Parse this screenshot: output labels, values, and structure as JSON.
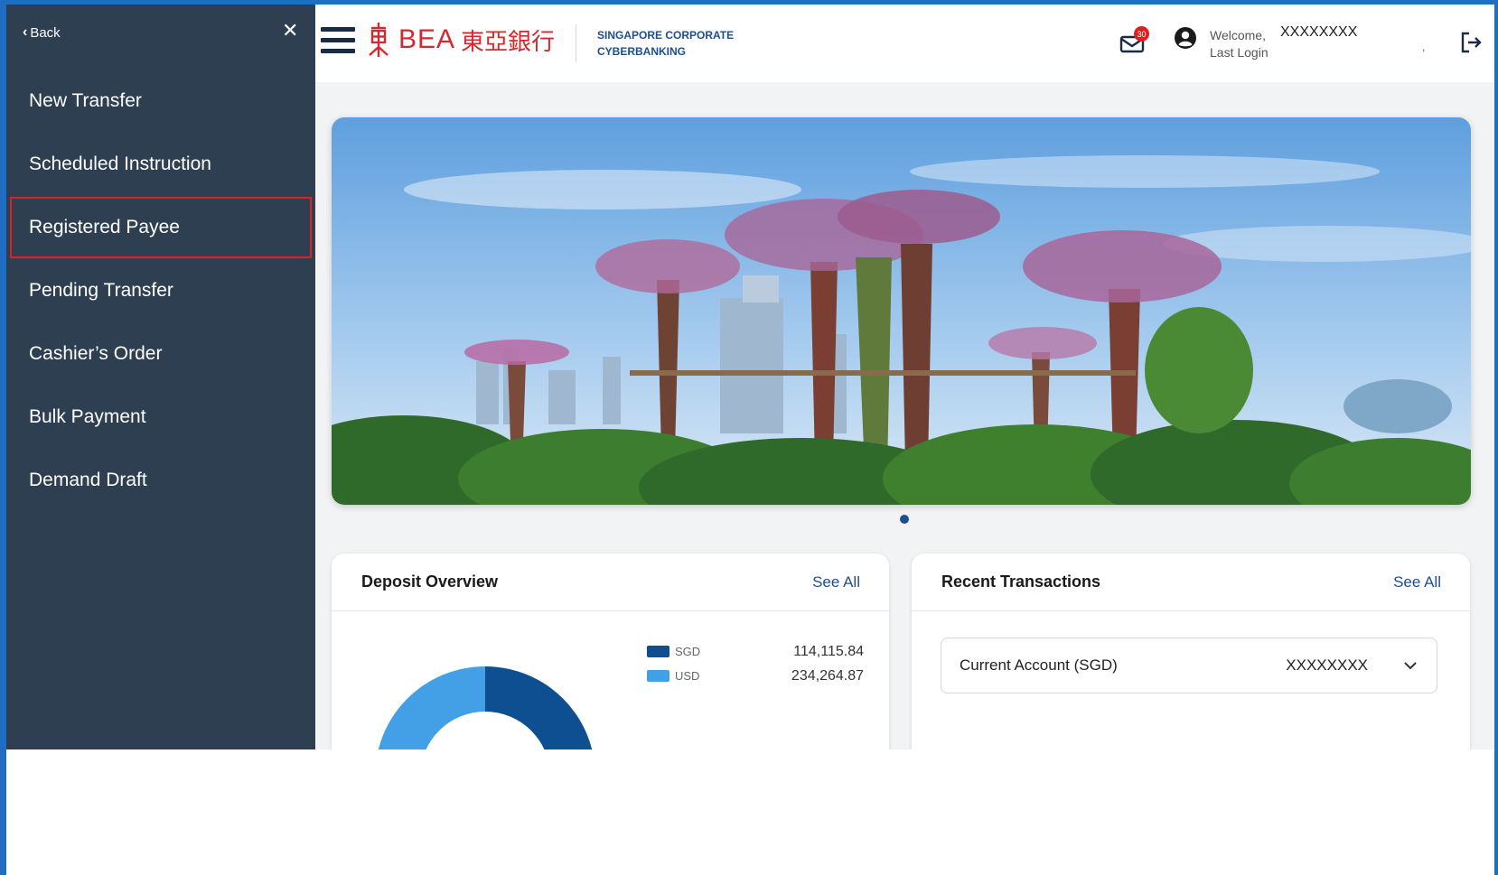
{
  "sidebar": {
    "back_label": "Back",
    "close_glyph": "✕",
    "items": [
      {
        "label": "New Transfer",
        "active": false
      },
      {
        "label": "Scheduled Instruction",
        "active": false
      },
      {
        "label": "Registered Payee",
        "active": true
      },
      {
        "label": "Pending Transfer",
        "active": false
      },
      {
        "label": "Cashier’s Order",
        "active": false
      },
      {
        "label": "Bulk Payment",
        "active": false
      },
      {
        "label": "Demand Draft",
        "active": false
      }
    ]
  },
  "header": {
    "brand": "BEA",
    "brand_cn": "東亞銀行",
    "product_line1": "SINGAPORE CORPORATE",
    "product_line2": "CYBERBANKING",
    "mail_count": "30",
    "welcome": "Welcome,",
    "last_login": "Last Login",
    "username": "XXXXXXXX",
    "comma": ","
  },
  "deposit": {
    "title": "Deposit Overview",
    "see_all": "See All",
    "legend": [
      {
        "currency": "SGD",
        "amount": "114,115.84",
        "color": "#0d4f91"
      },
      {
        "currency": "USD",
        "amount": "234,264.87",
        "color": "#44a0e6"
      }
    ]
  },
  "recent": {
    "title": "Recent Transactions",
    "see_all": "See All",
    "account_name": "Current Account (SGD)",
    "account_number": "XXXXXXXX"
  },
  "colors": {
    "sidebar_bg": "#2e3f52",
    "brand_red": "#d7282f",
    "link_blue": "#1d4e8f",
    "active_outline": "#e02020"
  }
}
